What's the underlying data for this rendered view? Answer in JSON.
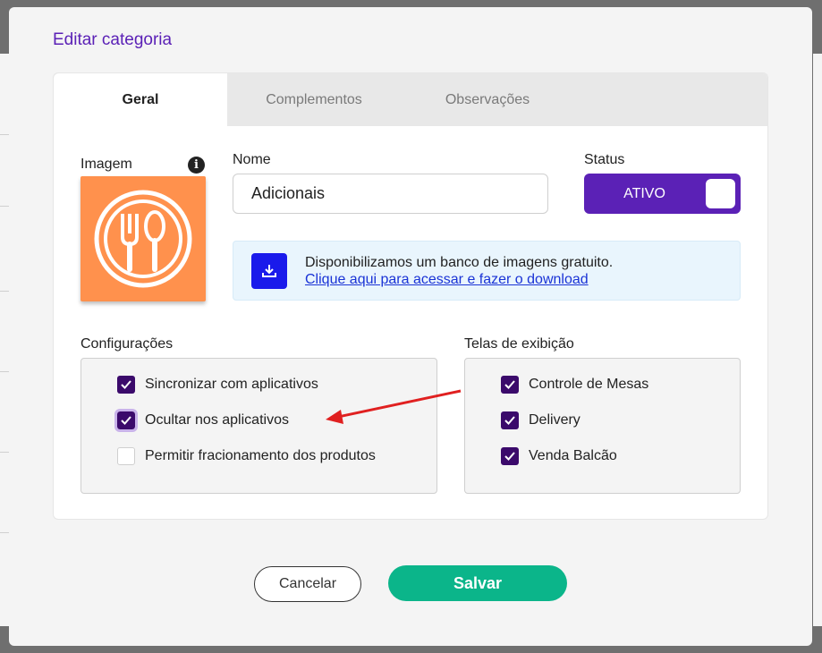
{
  "modal": {
    "title": "Editar categoria",
    "tabs": [
      {
        "label": "Geral",
        "active": true
      },
      {
        "label": "Complementos",
        "active": false
      },
      {
        "label": "Observações",
        "active": false
      }
    ],
    "image_label": "Imagem",
    "info_glyph": "i",
    "name": {
      "label": "Nome",
      "value": "Adicionais"
    },
    "status": {
      "label": "Status",
      "value": "ATIVO",
      "on": true
    },
    "notice": {
      "message": "Disponibilizamos um banco de imagens gratuito.",
      "link_text": "Clique aqui para acessar e fazer o download"
    },
    "config": {
      "label": "Configurações",
      "items": [
        {
          "label": "Sincronizar com aplicativos",
          "checked": true
        },
        {
          "label": "Ocultar nos aplicativos",
          "checked": true
        },
        {
          "label": "Permitir fracionamento dos produtos",
          "checked": false
        }
      ]
    },
    "screens": {
      "label": "Telas de exibição",
      "items": [
        {
          "label": "Controle de Mesas",
          "checked": true
        },
        {
          "label": "Delivery",
          "checked": true
        },
        {
          "label": "Venda Balcão",
          "checked": true
        }
      ]
    },
    "buttons": {
      "cancel": "Cancelar",
      "save": "Salvar"
    }
  },
  "colors": {
    "accent": "#5b21b6",
    "checkbox": "#3b0a6b",
    "save": "#0bb58a",
    "image_bg": "#ff914d",
    "arrow": "#e02020"
  }
}
